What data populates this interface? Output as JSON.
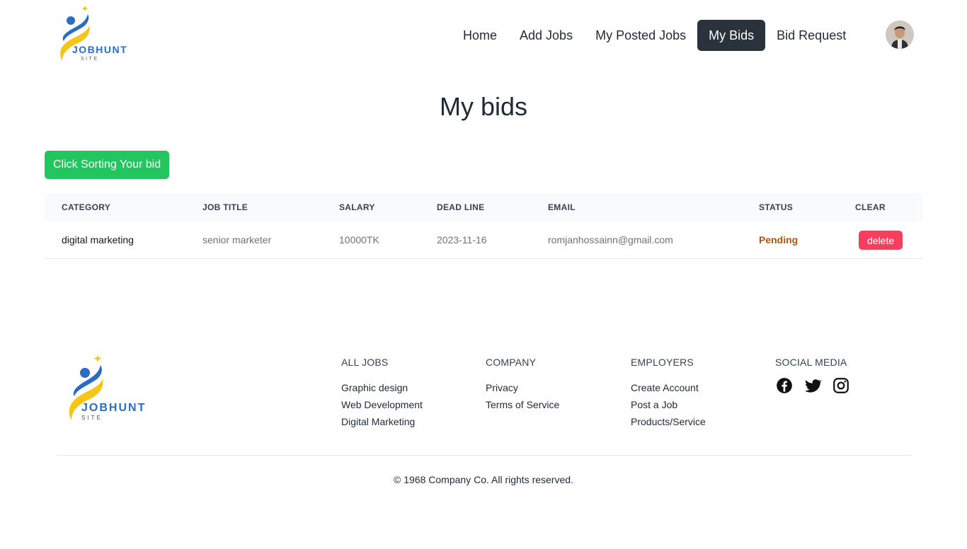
{
  "brand": {
    "name": "JOBHUNT",
    "sub": "SITE"
  },
  "nav": {
    "items": [
      {
        "label": "Home"
      },
      {
        "label": "Add Jobs"
      },
      {
        "label": "My Posted Jobs"
      },
      {
        "label": "My Bids"
      },
      {
        "label": "Bid Request"
      }
    ],
    "active": "My Bids"
  },
  "page": {
    "title": "My bids",
    "sort_button": "Click Sorting Your bid"
  },
  "table": {
    "headers": [
      "CATEGORY",
      "JOB TITLE",
      "SALARY",
      "DEAD LINE",
      "EMAIL",
      "STATUS",
      "CLEAR"
    ],
    "rows": [
      {
        "category": "digital marketing",
        "job_title": "senior marketer",
        "salary": "10000TK",
        "deadline": "2023-11-16",
        "email": "romjanhossainn@gmail.com",
        "status": "Pending",
        "action": "delete"
      }
    ]
  },
  "footer": {
    "columns": [
      {
        "heading": "ALL JOBS",
        "links": [
          "Graphic design",
          "Web Development",
          "Digital Marketing"
        ]
      },
      {
        "heading": "COMPANY",
        "links": [
          "Privacy",
          "Terms of Service"
        ]
      },
      {
        "heading": "EMPLOYERS",
        "links": [
          "Create Account",
          "Post a Job",
          "Products/Service"
        ]
      }
    ],
    "social_heading": "SOCIAL MEDIA",
    "social_icons": [
      "facebook-icon",
      "twitter-icon",
      "instagram-icon"
    ],
    "copyright": "© 1968 Company Co. All rights reserved."
  },
  "colors": {
    "accent_green": "#22c55e",
    "delete_red": "#f43f5e",
    "status_pending": "#b45309",
    "nav_active": "#2a323c",
    "logo_blue": "#2b6cc4",
    "logo_yellow": "#f5c518"
  }
}
